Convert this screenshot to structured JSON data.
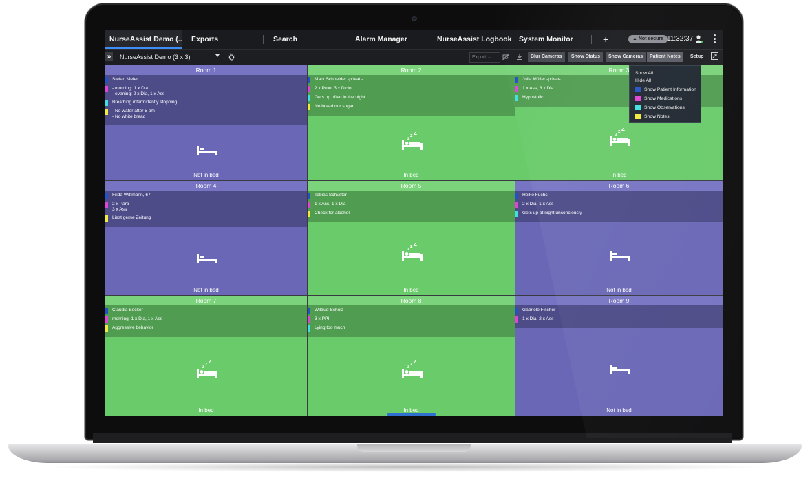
{
  "tabs": [
    {
      "label": "NurseAssist Demo (..."
    },
    {
      "label": "Exports"
    },
    {
      "label": "Search"
    },
    {
      "label": "Alarm Manager"
    },
    {
      "label": "NurseAssist Logbook"
    },
    {
      "label": "System Monitor"
    }
  ],
  "header": {
    "add_tab": "+",
    "not_secure": "▲ Not secure",
    "time": "11:32:37"
  },
  "toolbar": {
    "expand": "»",
    "view_name": "NurseAssist Demo (3 x 3)",
    "export": "Export",
    "blur_cameras": "Blur Cameras",
    "show_status": "Show Status",
    "show_cameras": "Show Cameras",
    "patient_notes": "Patient Notes",
    "setup": "Setup"
  },
  "colors": {
    "patient_info": "#2352c4",
    "medications": "#e044d6",
    "observations": "#3fe0e0",
    "notes": "#f4ea3e",
    "purple": "#6a68b6",
    "green": "#69cb6a"
  },
  "rooms": [
    {
      "title": "Room 1",
      "status": "Not in bed",
      "state": "purple",
      "sleeping": false,
      "notes": [
        {
          "type": "patient_info",
          "lines": [
            "Stefan Meier"
          ]
        },
        {
          "type": "medications",
          "lines": [
            "- morning: 1 x Dia",
            "- evening: 2 x Dia, 1 x Ass"
          ]
        },
        {
          "type": "observations",
          "lines": [
            "Breathing intermittently stopping"
          ]
        },
        {
          "type": "notes",
          "lines": [
            "- No water after 5 pm",
            "- No white bread"
          ]
        }
      ]
    },
    {
      "title": "Room 2",
      "status": "In bed",
      "state": "green",
      "sleeping": true,
      "notes": [
        {
          "type": "patient_info",
          "lines": [
            "Mark Schneider -privat -"
          ]
        },
        {
          "type": "medications",
          "lines": [
            "2 x Pron, 3 x Diclo"
          ]
        },
        {
          "type": "observations",
          "lines": [
            "Gets up often in the night"
          ]
        },
        {
          "type": "notes",
          "lines": [
            "No bread nor sugar"
          ]
        }
      ]
    },
    {
      "title": "Room 3",
      "status": "In bed",
      "state": "green",
      "sleeping": true,
      "notes": [
        {
          "type": "patient_info",
          "lines": [
            "Julia Müller -privat-"
          ]
        },
        {
          "type": "medications",
          "lines": [
            "1 x Ass, 3 x Dia"
          ]
        },
        {
          "type": "observations",
          "lines": [
            "Hypostolic"
          ]
        }
      ]
    },
    {
      "title": "Room 4",
      "status": "Not in bed",
      "state": "purple",
      "sleeping": false,
      "notes": [
        {
          "type": "patient_info",
          "lines": [
            "Frida Wittmann, 67"
          ]
        },
        {
          "type": "medications",
          "lines": [
            "2 x Para",
            "3 x Ass"
          ]
        },
        {
          "type": "notes",
          "lines": [
            "Liest gerne Zeitung"
          ]
        }
      ]
    },
    {
      "title": "Room 5",
      "status": "In bed",
      "state": "green",
      "sleeping": true,
      "notes": [
        {
          "type": "patient_info",
          "lines": [
            "Tobias Schuster"
          ]
        },
        {
          "type": "medications",
          "lines": [
            "1 x Ass, 1 x Dia"
          ]
        },
        {
          "type": "notes",
          "lines": [
            "Check for alcohol"
          ]
        }
      ]
    },
    {
      "title": "Room 6",
      "status": "Not in bed",
      "state": "purple",
      "sleeping": false,
      "notes": [
        {
          "type": "patient_info",
          "lines": [
            "Heiko Fuchs"
          ]
        },
        {
          "type": "medications",
          "lines": [
            "2 x Dia, 1 x Ass"
          ]
        },
        {
          "type": "observations",
          "lines": [
            "Gets up at night unconciously"
          ]
        }
      ]
    },
    {
      "title": "Room 7",
      "status": "In bed",
      "state": "green",
      "sleeping": true,
      "notes": [
        {
          "type": "patient_info",
          "lines": [
            "Claudia Becker"
          ]
        },
        {
          "type": "medications",
          "lines": [
            "morning: 1 x Dia, 1 x Ass"
          ]
        },
        {
          "type": "notes",
          "lines": [
            "Aggressive behavior"
          ]
        }
      ]
    },
    {
      "title": "Room 8",
      "status": "In bed",
      "state": "green",
      "sleeping": true,
      "notes": [
        {
          "type": "patient_info",
          "lines": [
            "Wiltrud Scholz"
          ]
        },
        {
          "type": "medications",
          "lines": [
            "3 x PPI"
          ]
        },
        {
          "type": "observations",
          "lines": [
            "Lying too much"
          ]
        }
      ]
    },
    {
      "title": "Room 9",
      "status": "Not in bed",
      "state": "purple",
      "sleeping": false,
      "notes": [
        {
          "type": "patient_info",
          "lines": [
            "Gabriele Fischer"
          ]
        },
        {
          "type": "medications",
          "lines": [
            "1 x Dia, 2 x Ass"
          ]
        }
      ]
    }
  ],
  "notes_menu": {
    "show_all": "Show All",
    "hide_all": "Hide All",
    "items": [
      {
        "label": "Show Patient Information",
        "type": "patient_info"
      },
      {
        "label": "Show Medications",
        "type": "medications"
      },
      {
        "label": "Show Observations",
        "type": "observations"
      },
      {
        "label": "Show Notes",
        "type": "notes"
      }
    ]
  }
}
